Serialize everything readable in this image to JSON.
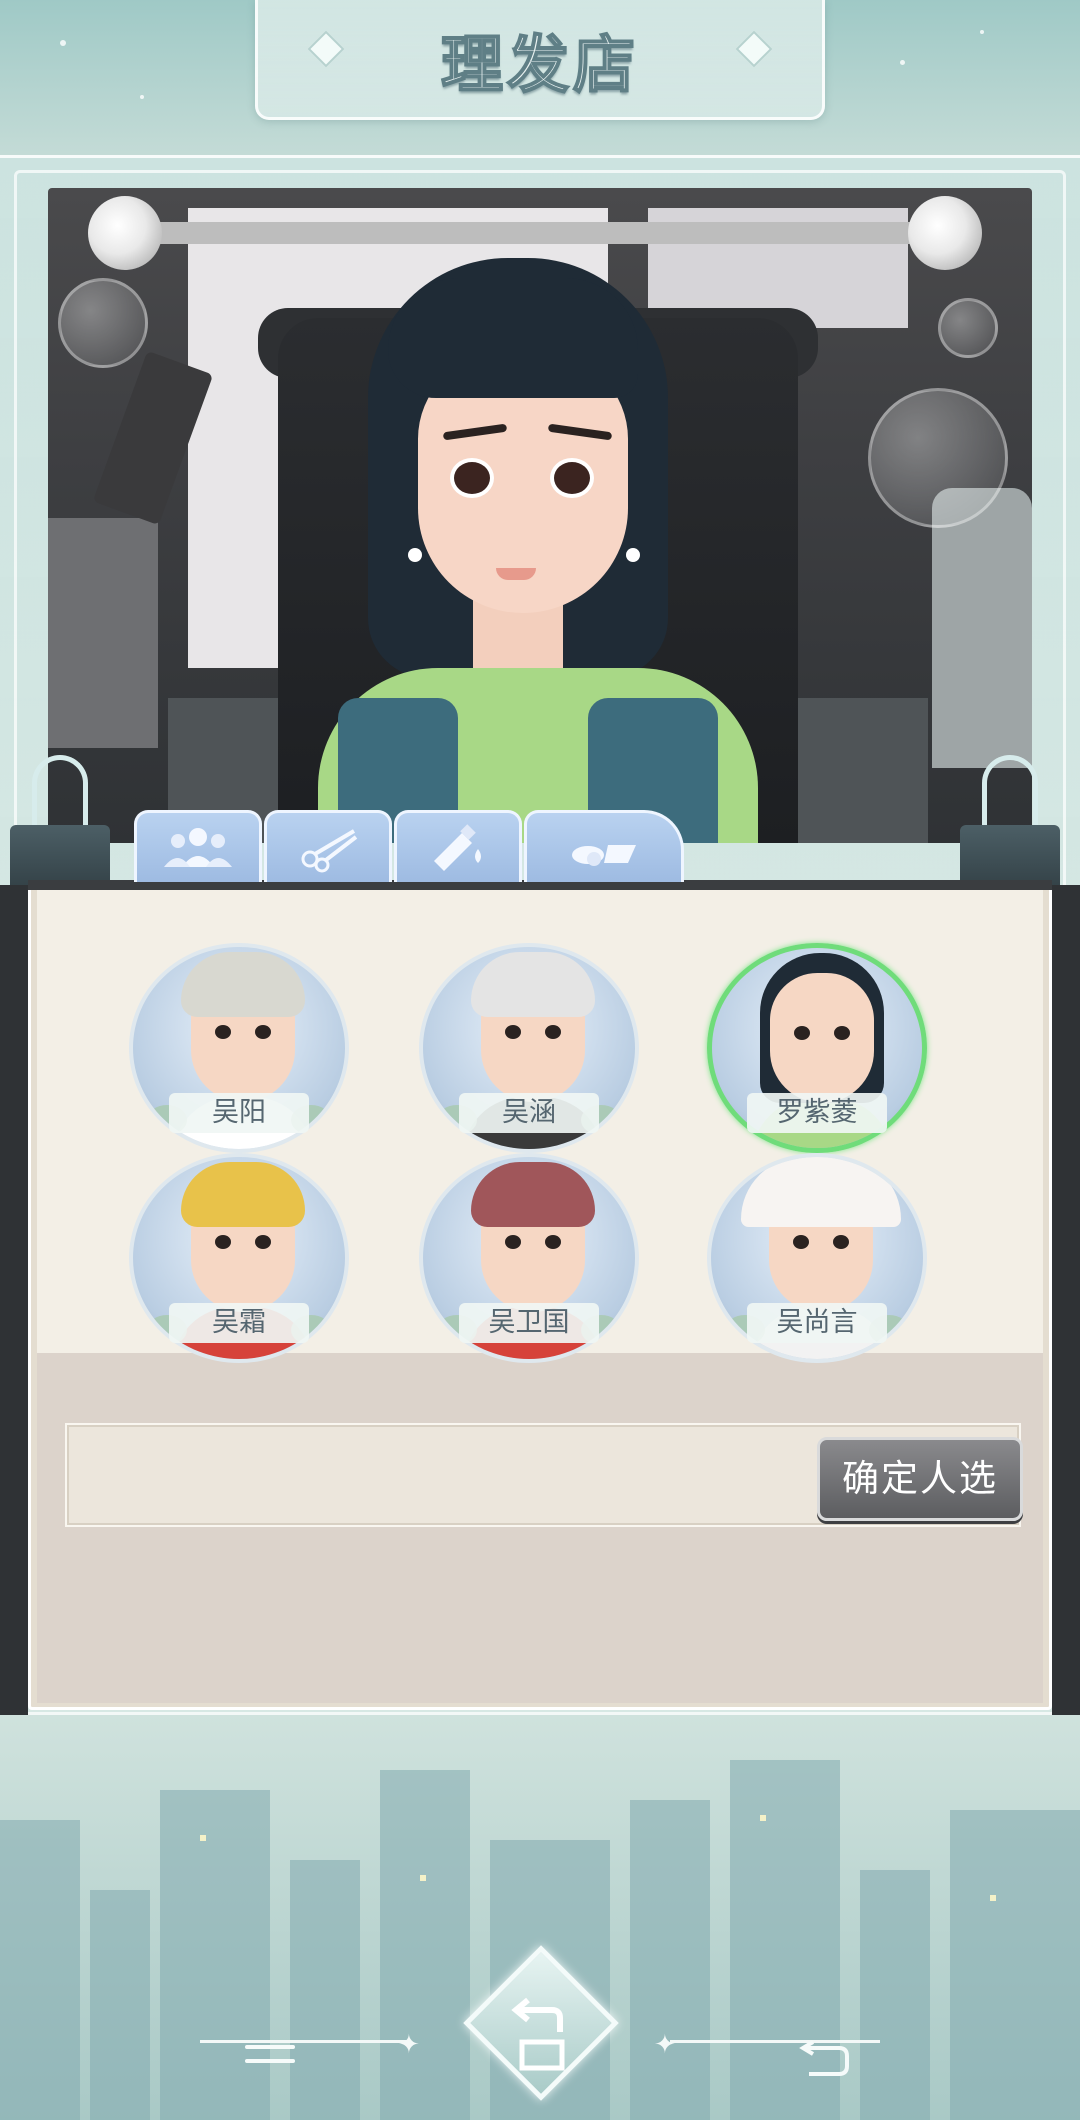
{
  "header": {
    "title": "理发店"
  },
  "tabs": [
    {
      "id": "characters",
      "icon": "people-icon",
      "active": true
    },
    {
      "id": "haircut",
      "icon": "scissors-icon",
      "active": false
    },
    {
      "id": "dye",
      "icon": "dye-tube-icon",
      "active": false
    },
    {
      "id": "accessories",
      "icon": "hat-icon",
      "active": false
    }
  ],
  "characters": [
    {
      "name": "吴阳",
      "hair": "#d8d8d0",
      "shirt": "#ffffff",
      "selected": false
    },
    {
      "name": "吴涵",
      "hair": "#e4e4e4",
      "shirt": "#3a3a3a",
      "selected": false
    },
    {
      "name": "罗紫菱",
      "hair": "#1f2b36",
      "shirt": "#a8d886",
      "selected": true
    },
    {
      "name": "吴霜",
      "hair": "#e8c24a",
      "shirt": "#d6423a",
      "selected": false
    },
    {
      "name": "吴卫国",
      "hair": "#a0565a",
      "shirt": "#d6423a",
      "selected": false
    },
    {
      "name": "吴尚言",
      "hair": "#8a5a3c",
      "shirt": "#f2f2f2",
      "selected": false
    }
  ],
  "actions": {
    "confirm_label": "确定人选"
  },
  "colors": {
    "accent_green": "#6fdc7a",
    "tab_blue": "#a9c4e8",
    "frame_teal": "#cfe2dd"
  }
}
